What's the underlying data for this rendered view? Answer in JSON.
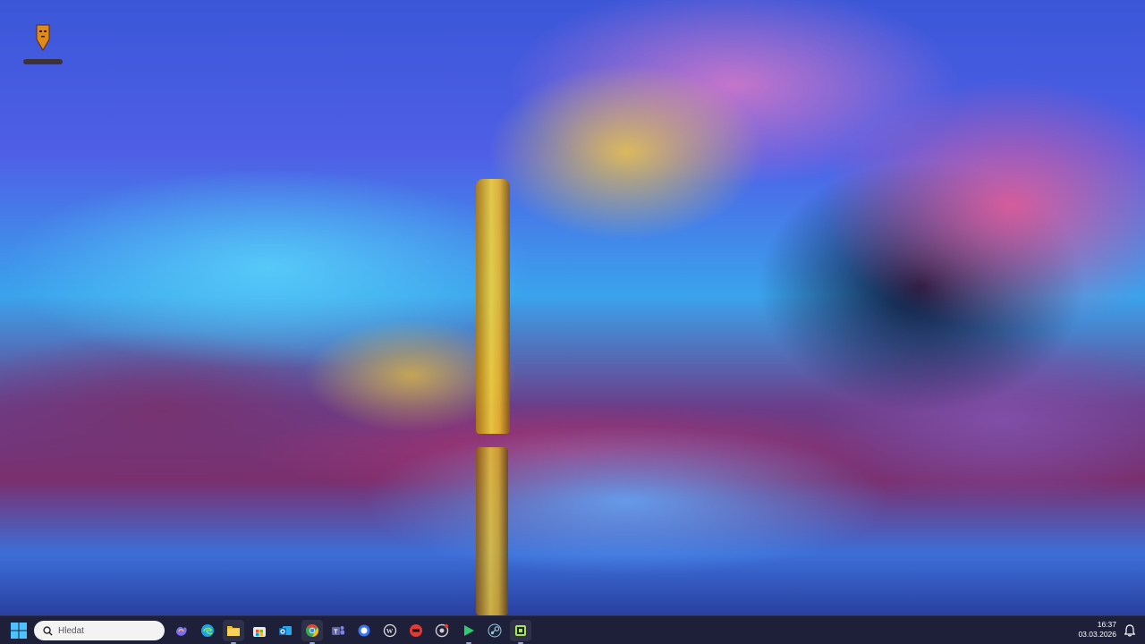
{
  "desktop": {
    "wallpaper": "illuminated-cave-lake",
    "icons": [
      {
        "name": "desktop-shortcut",
        "icon": "tribal-mask-icon",
        "label": ""
      }
    ]
  },
  "taskbar": {
    "background": "#1d2038",
    "start_icon": "windows-start-icon",
    "search": {
      "placeholder": "Hledat",
      "icon": "search-icon"
    },
    "apps": [
      {
        "name": "copilot",
        "icon": "copilot-icon",
        "color": "#7b6cf6"
      },
      {
        "name": "edge",
        "icon": "edge-icon",
        "color": "#1fa3e0"
      },
      {
        "name": "file-explorer",
        "icon": "folder-icon",
        "color": "#f3c033"
      },
      {
        "name": "microsoft-store",
        "icon": "store-icon",
        "color": "#f25022"
      },
      {
        "name": "outlook",
        "icon": "mail-icon",
        "color": "#0f6cbd"
      },
      {
        "name": "chrome",
        "icon": "chrome-icon",
        "color": "#34a853"
      },
      {
        "name": "teams",
        "icon": "teams-icon",
        "color": "#6264a7"
      },
      {
        "name": "signal",
        "icon": "chat-bubble-icon",
        "color": "#3a76f0"
      },
      {
        "name": "wordpress",
        "icon": "wordpress-icon",
        "color": "#dddddd"
      },
      {
        "name": "media-app",
        "icon": "red-badge-icon",
        "color": "#e53935"
      },
      {
        "name": "github-desktop",
        "icon": "github-icon",
        "color": "#cfcfcf"
      },
      {
        "name": "media-player",
        "icon": "play-icon",
        "color": "#2ecc71"
      },
      {
        "name": "steam",
        "icon": "steam-icon",
        "color": "#9ec3e6"
      },
      {
        "name": "terminal-app",
        "icon": "android-icon",
        "color": "#a4e84a"
      }
    ],
    "clock": {
      "time": "16:37",
      "date": "03.03.2026"
    },
    "notification_icon": "notification-bell-icon"
  }
}
